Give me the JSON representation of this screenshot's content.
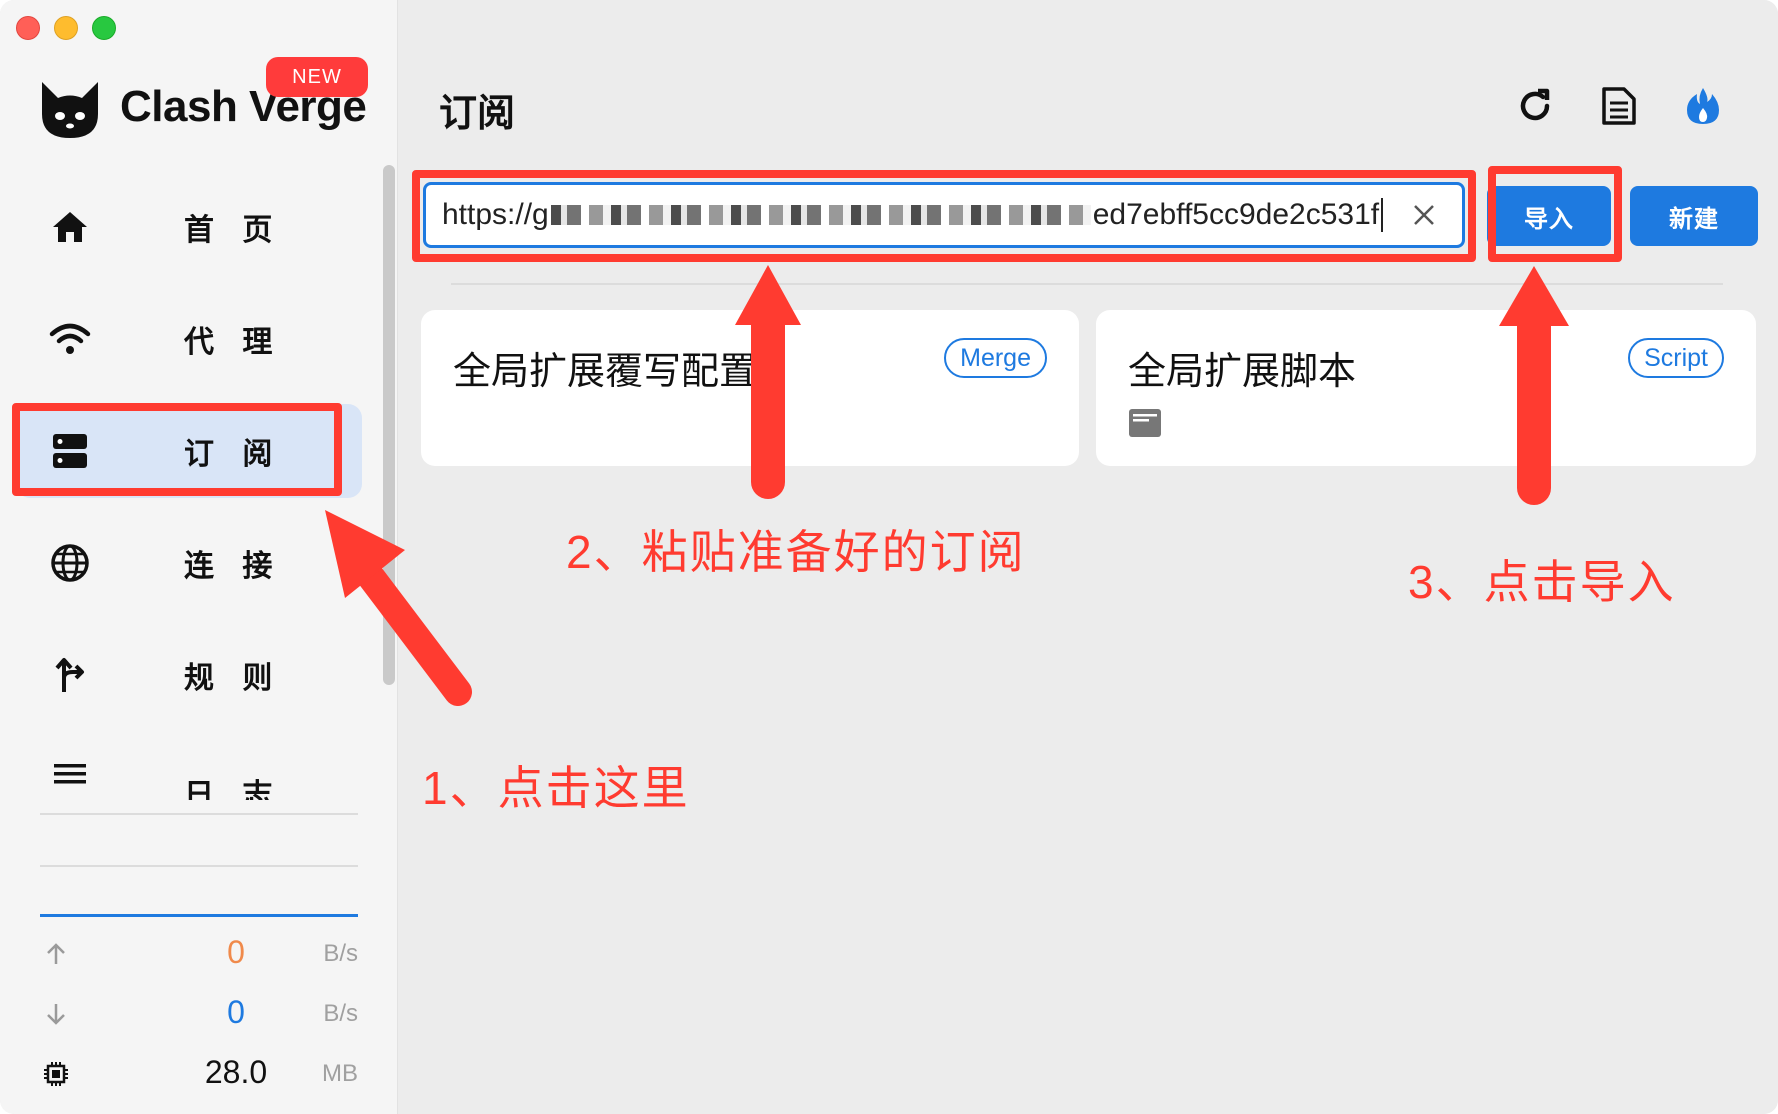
{
  "app": {
    "name": "Clash Verge",
    "badge": "NEW"
  },
  "sidebar": {
    "items": [
      {
        "label": "首 页",
        "icon": "home-icon"
      },
      {
        "label": "代 理",
        "icon": "wifi-icon"
      },
      {
        "label": "订 阅",
        "icon": "server-icon",
        "active": true
      },
      {
        "label": "连 接",
        "icon": "globe-icon"
      },
      {
        "label": "规 则",
        "icon": "fork-icon"
      },
      {
        "label": "日 志",
        "icon": "menu-icon"
      }
    ]
  },
  "traffic": {
    "upload": {
      "value": "0",
      "unit": "B/s",
      "icon": "arrow-up-icon",
      "color": "#f08a4b"
    },
    "download": {
      "value": "0",
      "unit": "B/s",
      "icon": "arrow-down-icon",
      "color": "#1e7ae0"
    },
    "memory": {
      "value": "28.0",
      "unit": "MB",
      "icon": "chip-icon",
      "color": "#111111"
    }
  },
  "main": {
    "title": "订阅",
    "header_icons": [
      "refresh-icon",
      "document-icon",
      "fire-icon"
    ],
    "url_input": {
      "prefix": "https://g",
      "suffix": "ed7ebff5cc9de2c531f"
    },
    "import_button": "导入",
    "new_button": "新建",
    "cards": [
      {
        "title": "全局扩展覆写配置",
        "tag": "Merge"
      },
      {
        "title": "全局扩展脚本",
        "tag": "Script",
        "icon": "file-icon"
      }
    ]
  },
  "annotations": {
    "step1": "1、点击这里",
    "step2": "2、粘贴准备好的订阅",
    "step3": "3、点击导入"
  },
  "colors": {
    "accent": "#1e7ae0",
    "annotation": "#ff3b30",
    "active_nav": "#d9e5f7"
  }
}
